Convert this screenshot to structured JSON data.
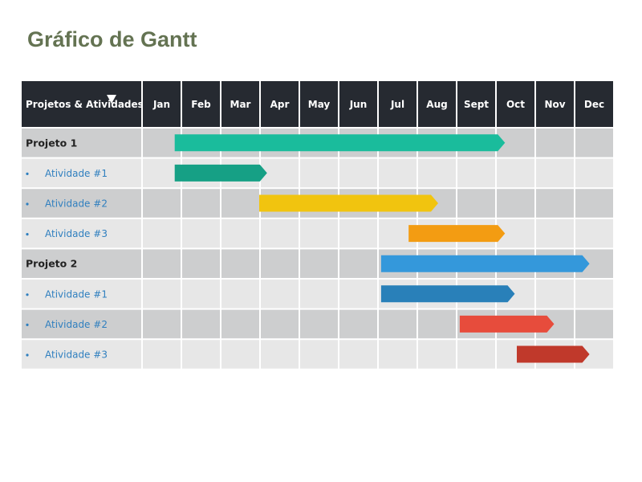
{
  "chart_data": {
    "type": "gantt",
    "title": "Gráfico de Gantt",
    "header_label": "Projetos & Atividades",
    "months": [
      "Jan",
      "Feb",
      "Mar",
      "Apr",
      "May",
      "Jun",
      "Jul",
      "Aug",
      "Sept",
      "Oct",
      "Nov",
      "Dec"
    ],
    "units": "months from start of Jan (0 = start of Jan, 12 = end of Dec)",
    "rows": [
      {
        "label": "Projeto 1",
        "kind": "project",
        "start": 0.85,
        "end": 9.25,
        "color": "#1abc9c"
      },
      {
        "label": "Atividade #1",
        "kind": "activity",
        "start": 0.85,
        "end": 3.2,
        "color": "#16a085"
      },
      {
        "label": "Atividade #2",
        "kind": "activity",
        "start": 3.0,
        "end": 7.55,
        "color": "#f1c40f"
      },
      {
        "label": "Atividade #3",
        "kind": "activity",
        "start": 6.8,
        "end": 9.25,
        "color": "#f39c12"
      },
      {
        "label": "Projeto 2",
        "kind": "project",
        "start": 6.1,
        "end": 11.4,
        "color": "#3498db"
      },
      {
        "label": "Atividade #1",
        "kind": "activity",
        "start": 6.1,
        "end": 9.5,
        "color": "#2980b9"
      },
      {
        "label": "Atividade #2",
        "kind": "activity",
        "start": 8.1,
        "end": 10.5,
        "color": "#e74c3c"
      },
      {
        "label": "Atividade #3",
        "kind": "activity",
        "start": 9.55,
        "end": 11.4,
        "color": "#c0392b"
      }
    ],
    "bullet": "•"
  },
  "colors": {
    "title": "#647352",
    "header_bg": "#262a31",
    "row_dark": "#cdcecf",
    "row_light": "#e7e7e7",
    "grid": "#ffffff",
    "project_text": "#222222",
    "activity_text": "#2f7fbf"
  },
  "cursor_icon": "triangle-cursor-icon"
}
